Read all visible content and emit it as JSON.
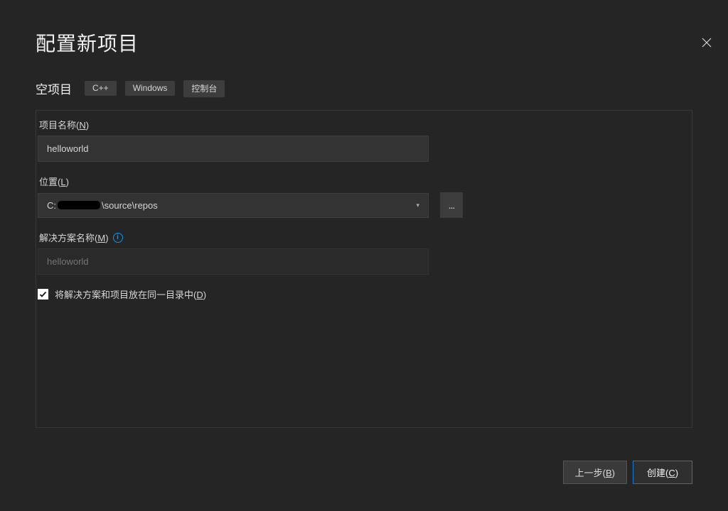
{
  "title": "配置新项目",
  "template": {
    "name": "空项目",
    "tags": [
      "C++",
      "Windows",
      "控制台"
    ]
  },
  "fields": {
    "projectName": {
      "label": "项目名称",
      "hotkey": "N",
      "value": "helloworld"
    },
    "location": {
      "label": "位置",
      "hotkey": "L",
      "prefix": "C:",
      "suffix": "\\source\\repos",
      "browse": "..."
    },
    "solutionName": {
      "label": "解决方案名称",
      "hotkey": "M",
      "placeholder": "helloworld"
    },
    "sameDir": {
      "label": "将解决方案和项目放在同一目录中",
      "hotkey": "D",
      "checked": true
    }
  },
  "buttons": {
    "back": {
      "label": "上一步",
      "hotkey": "B"
    },
    "create": {
      "label": "创建",
      "hotkey": "C"
    }
  }
}
